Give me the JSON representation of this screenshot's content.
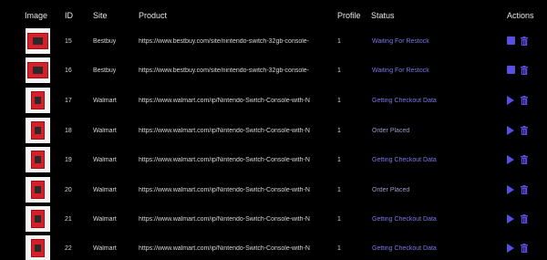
{
  "header": {
    "image": "Image",
    "id": "ID",
    "site": "Site",
    "product": "Product",
    "profile": "Profile",
    "status": "Status",
    "actions": "Actions"
  },
  "colors": {
    "accent": "#5a4fe0",
    "status_active": "#7d76e8",
    "status_placed": "#9a9acb"
  },
  "rows": [
    {
      "id": "15",
      "site": "Bestbuy",
      "product": "https://www.bestbuy.com/site/nintendo-switch-32gb-console-",
      "profile": "1",
      "status": "Waiting For Restock",
      "primary_action_icon": "stop-icon"
    },
    {
      "id": "16",
      "site": "Bestbuy",
      "product": "https://www.bestbuy.com/site/nintendo-switch-32gb-console-",
      "profile": "1",
      "status": "Waiting For Restock",
      "primary_action_icon": "stop-icon"
    },
    {
      "id": "17",
      "site": "Walmart",
      "product": "https://www.walmart.com/ip/Nintendo-Switch-Console-with-N",
      "profile": "1",
      "status": "Getting Checkout Data",
      "primary_action_icon": "play-icon"
    },
    {
      "id": "18",
      "site": "Walmart",
      "product": "https://www.walmart.com/ip/Nintendo-Switch-Console-with-N",
      "profile": "1",
      "status": "Order Placed",
      "primary_action_icon": "play-icon"
    },
    {
      "id": "19",
      "site": "Walmart",
      "product": "https://www.walmart.com/ip/Nintendo-Switch-Console-with-N",
      "profile": "1",
      "status": "Getting Checkout Data",
      "primary_action_icon": "play-icon"
    },
    {
      "id": "20",
      "site": "Walmart",
      "product": "https://www.walmart.com/ip/Nintendo-Switch-Console-with-N",
      "profile": "1",
      "status": "Order Placed",
      "primary_action_icon": "play-icon"
    },
    {
      "id": "21",
      "site": "Walmart",
      "product": "https://www.walmart.com/ip/Nintendo-Switch-Console-with-N",
      "profile": "1",
      "status": "Getting Checkout Data",
      "primary_action_icon": "play-icon"
    },
    {
      "id": "22",
      "site": "Walmart",
      "product": "https://www.walmart.com/ip/Nintendo-Switch-Console-with-N",
      "profile": "1",
      "status": "Getting Checkout Data",
      "primary_action_icon": "play-icon"
    }
  ]
}
